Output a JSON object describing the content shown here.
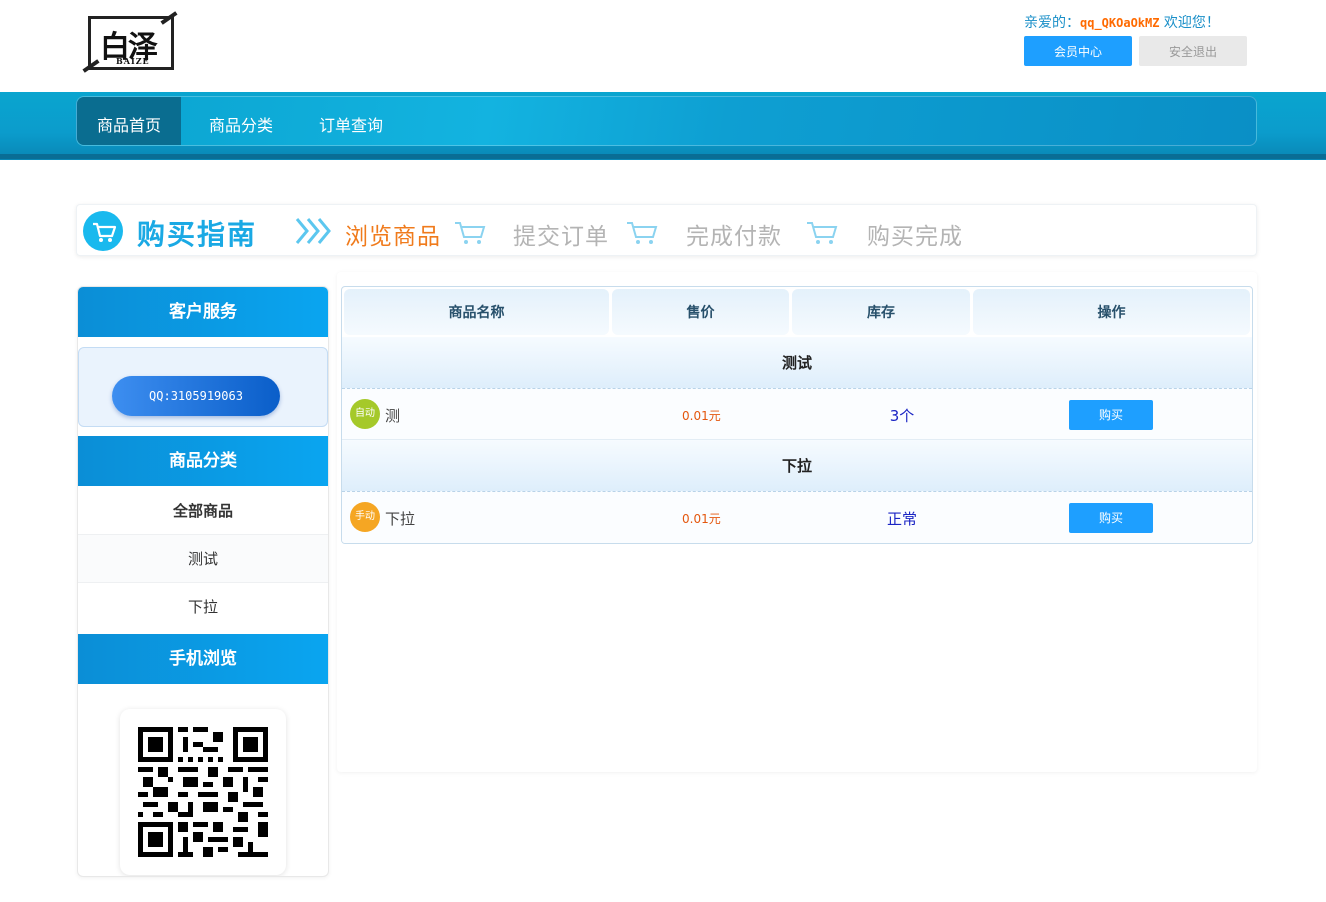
{
  "header": {
    "logo": {
      "title": "白泽",
      "subtitle": "BAIZE"
    },
    "welcome_prefix": "亲爱的：",
    "username": "qq_QKOaOkMZ",
    "welcome_suffix": " 欢迎您！",
    "member_button": "会员中心",
    "logout_button": "安全退出"
  },
  "nav": {
    "items": [
      "商品首页",
      "商品分类",
      "订单查询"
    ],
    "active": 0
  },
  "guide": {
    "title": "购买指南",
    "steps": [
      "浏览商品",
      "提交订单",
      "完成付款",
      "购买完成"
    ],
    "active_step": 0
  },
  "sidebar": {
    "service_title": "客户服务",
    "qq_label": "QQ:3105919063",
    "category_title": "商品分类",
    "categories": [
      "全部商品",
      "测试",
      "下拉"
    ],
    "mobile_title": "手机浏览"
  },
  "table": {
    "headers": [
      "商品名称",
      "售价",
      "库存",
      "操作"
    ],
    "groups": [
      {
        "name": "测试",
        "rows": [
          {
            "badge": "自动",
            "badge_color": "#a5c92a",
            "name": "测",
            "price": "0.01元",
            "stock": "3个",
            "action": "购买"
          }
        ]
      },
      {
        "name": "下拉",
        "rows": [
          {
            "badge": "手动",
            "badge_color": "#f5a623",
            "name": "下拉",
            "price": "0.01元",
            "stock": "正常",
            "action": "购买"
          }
        ]
      }
    ]
  },
  "colors": {
    "primary": "#1e9fff",
    "nav": "#0aa5cf",
    "accent": "#f07b1c",
    "price": "#e4570e",
    "stock": "#1a24c4"
  }
}
